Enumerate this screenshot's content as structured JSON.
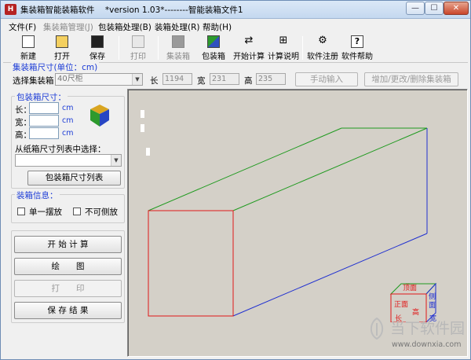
{
  "window": {
    "title": "集装箱智能装箱软件    *version 1.03*--------智能装箱文件1",
    "icon_label": "H",
    "controls": {
      "minimize": "—",
      "maximize": "☐",
      "close": "✕"
    }
  },
  "menu": [
    {
      "label": "文件(F)",
      "disabled": false
    },
    {
      "label": "集装箱管理(J)",
      "disabled": true
    },
    {
      "label": "包装箱处理(B)",
      "disabled": false
    },
    {
      "label": "装箱处理(R)",
      "disabled": false
    },
    {
      "label": "帮助(H)",
      "disabled": false
    }
  ],
  "toolbar": {
    "new": "新建",
    "open": "打开",
    "save": "保存",
    "print": "打印",
    "container": "集装箱",
    "packing": "包装箱",
    "start_calc": "开始计算",
    "calc_help": "计算说明",
    "register": "软件注册",
    "help": "软件帮助"
  },
  "container_bar": {
    "group_title": "集装箱尺寸(单位：cm)",
    "select_label": "选择集装箱",
    "select_value": "40尺柜",
    "length_label": "长",
    "length_value": "1194",
    "width_label": "宽",
    "width_value": "231",
    "height_label": "高",
    "height_value": "235",
    "manual_input_button": "手动输入",
    "manage_button": "增加/更改/删除集装箱"
  },
  "package_box": {
    "group_title": "包装箱尺寸：",
    "length_label": "长：",
    "width_label": "宽：",
    "height_label": "高：",
    "unit": "cm",
    "from_list_label": "从纸箱尺寸列表中选择：",
    "list_button": "包装箱尺寸列表"
  },
  "packing_info": {
    "group_title": "装箱信息：",
    "single_placement": "单一摆放",
    "no_side_placement": "不可侧放"
  },
  "actions": {
    "start_calc": "开 始 计 算",
    "draw": "绘　　图",
    "print": "打　　印",
    "save_result": "保 存 结 果"
  },
  "orientation_cube": {
    "top": "顶面",
    "front": "正面",
    "side_1": "侧",
    "side_2": "面",
    "length": "长",
    "height": "高",
    "width": "宽"
  },
  "watermark": {
    "brand": "当下软件园",
    "url": "www.downxia.com"
  },
  "colors": {
    "edge_top": "#1f9a1f",
    "edge_front": "#e01818",
    "edge_side": "#2030d0",
    "group_title": "#1b3bd6"
  }
}
